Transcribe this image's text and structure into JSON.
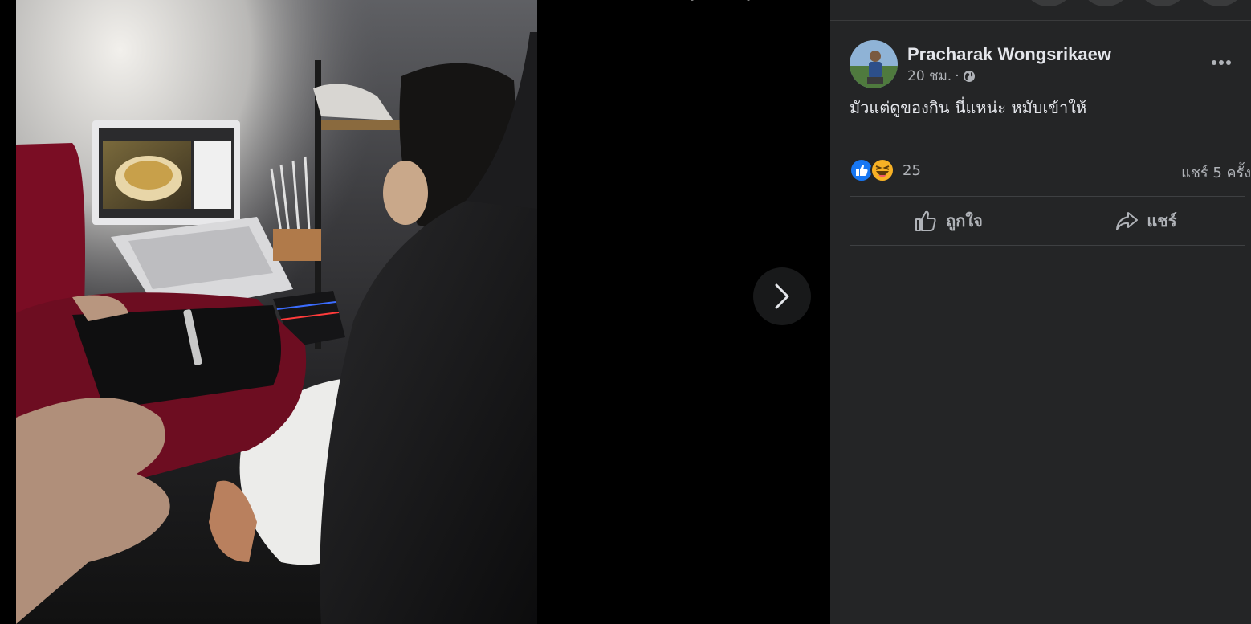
{
  "post": {
    "author": "Pracharak Wongsrikaew",
    "time": "20 ชม.",
    "separator": "·",
    "privacy_icon": "globe-icon",
    "caption": "มัวแต่ดูของกิน นี่แหน่ะ หมับเข้าให้",
    "more_icon": "more-options-icon"
  },
  "reactions": {
    "icons": [
      "like-reaction-icon",
      "haha-reaction-icon"
    ],
    "count": "25",
    "shares": "แชร์ 5 ครั้ง"
  },
  "actions": {
    "like_label": "ถูกใจ",
    "share_label": "แชร์"
  },
  "viewer": {
    "next_icon": "chevron-right-icon"
  },
  "colors": {
    "panel_bg": "#242526",
    "text_primary": "#e4e6eb",
    "text_secondary": "#b0b3b8",
    "like_blue": "#1877f2",
    "haha_yellow": "#f7b125"
  }
}
